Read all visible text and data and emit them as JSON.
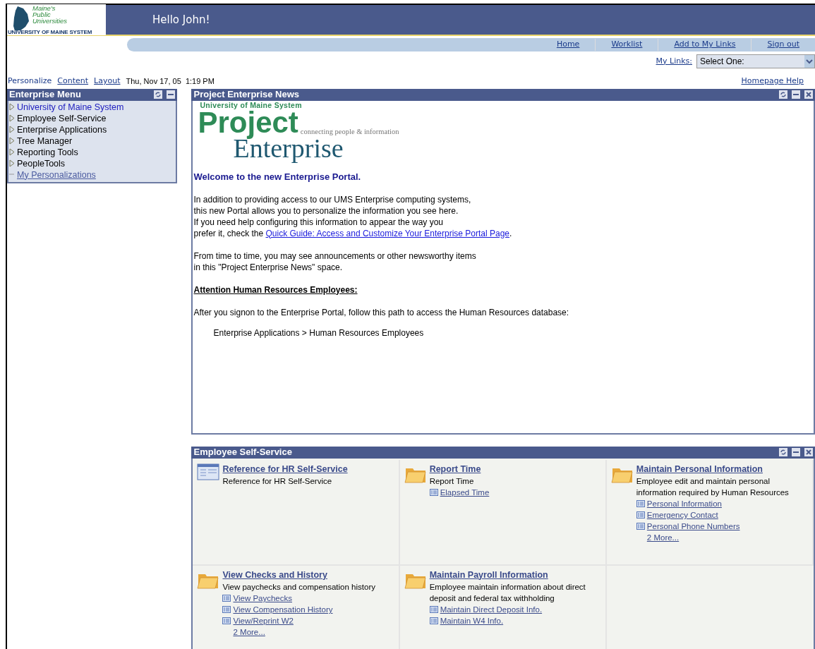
{
  "header": {
    "logo": {
      "lines": [
        "Maine's",
        "Public",
        "Universities"
      ],
      "footer": "UNIVERSITY OF MAINE SYSTEM"
    },
    "greeting": "Hello John!"
  },
  "nav": {
    "links": [
      "Home",
      "Worklist",
      "Add to My Links",
      "Sign out"
    ]
  },
  "my_links": {
    "label": "My Links:",
    "select": "Select One:"
  },
  "toolbar": {
    "links": [
      "Personalize",
      "Content",
      "Layout"
    ],
    "datetime": "Thu, Nov 17, 05  1:19 PM",
    "help": "Homepage Help"
  },
  "enterprise_menu": {
    "title": "Enterprise Menu",
    "items": [
      {
        "label": "University of Maine System",
        "kind": "folder",
        "selected": true
      },
      {
        "label": "Employee Self-Service",
        "kind": "folder",
        "selected": false
      },
      {
        "label": "Enterprise Applications",
        "kind": "folder",
        "selected": false
      },
      {
        "label": "Tree Manager",
        "kind": "folder",
        "selected": false
      },
      {
        "label": "Reporting Tools",
        "kind": "folder",
        "selected": false
      },
      {
        "label": "PeopleTools",
        "kind": "folder",
        "selected": false
      },
      {
        "label": "My Personalizations",
        "kind": "link",
        "selected": false
      }
    ]
  },
  "news": {
    "title": "Project Enterprise News",
    "logo": {
      "top": "University of Maine System",
      "word1": "Project",
      "tagline": "connecting people & information",
      "word2": "Enterprise"
    },
    "welcome": "Welcome to the new Enterprise Portal.",
    "intro": {
      "lines": [
        "In addition to providing access to our UMS Enterprise computing systems,",
        "this new Portal allows you to personalize the information you see here.",
        "If you need help configuring this information to appear the way you",
        "prefer it, check the "
      ],
      "link": "Quick Guide: Access and Customize Your Enterprise Portal Page",
      "tail": "."
    },
    "paragraph2": [
      "From time to time, you may see announcements or other newsworthy items",
      "in this \"Project Enterprise News\" space."
    ],
    "attention": "Attention Human Resources Employees:",
    "paragraph3": "After you signon to the Enterprise Portal, follow this path to access the Human Resources database:",
    "path": "Enterprise Applications > Human Resources Employees"
  },
  "self_service": {
    "title": "Employee Self-Service",
    "tiles": [
      {
        "kind": "page",
        "title": "Reference for HR Self-Service",
        "description": "Reference for HR Self-Service"
      },
      {
        "kind": "folder",
        "title": "Report Time",
        "description": "Report Time",
        "links": [
          "Elapsed Time"
        ]
      },
      {
        "kind": "folder",
        "title": "Maintain Personal Information",
        "description": "Employee edit and maintain personal information required by Human Resources",
        "links": [
          "Personal Information",
          "Emergency Contact",
          "Personal Phone Numbers"
        ],
        "more": "2 More..."
      },
      {
        "kind": "folder",
        "title": "View Checks and History",
        "description": "View paychecks and compensation history",
        "links": [
          "View Paychecks",
          "View Compensation History",
          "View/Reprint W2"
        ],
        "more": "2 More..."
      },
      {
        "kind": "folder",
        "title": "Maintain Payroll Information",
        "description": "Employee maintain information about direct deposit and federal tax withholding",
        "links": [
          "Maintain Direct Deposit Info.",
          "Maintain W4 Info."
        ]
      }
    ]
  }
}
